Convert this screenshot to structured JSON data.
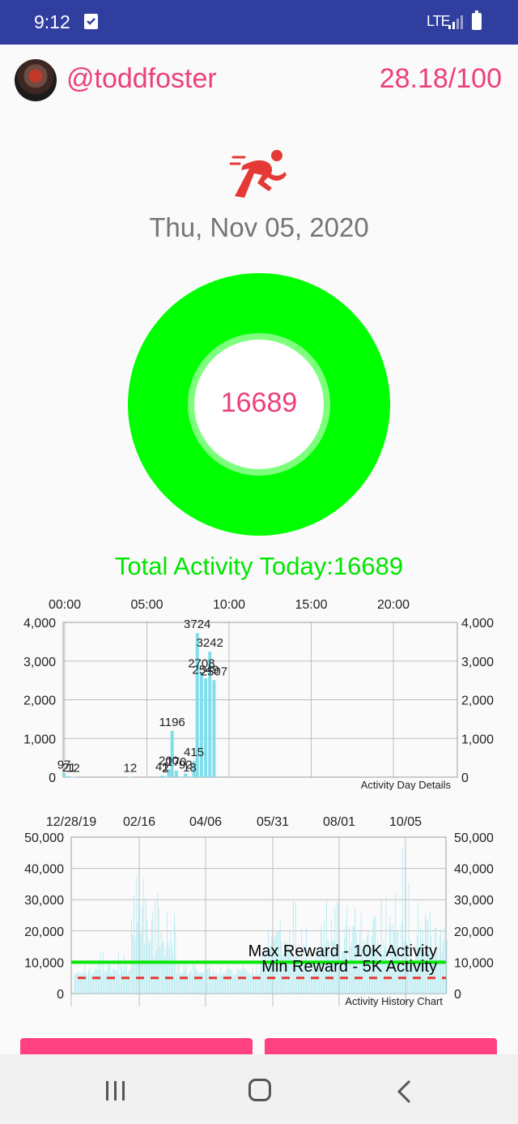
{
  "status_bar": {
    "time": "9:12",
    "network": "LTE",
    "icons": [
      "task-check-icon",
      "signal-icon",
      "battery-icon"
    ]
  },
  "header": {
    "username": "@toddfoster",
    "score": "28.18/100",
    "avatar": "user-avatar"
  },
  "activity_icon": "runner-icon",
  "date": "Thu, Nov 05, 2020",
  "ring": {
    "value": "16689",
    "color": "#00ff00"
  },
  "total_label": "Total Activity Today:16689",
  "chart_data": [
    {
      "type": "bar",
      "title": "Activity Day Details",
      "x_ticks": [
        "00:00",
        "05:00",
        "10:00",
        "15:00",
        "20:00"
      ],
      "x_range_hours": [
        0,
        24
      ],
      "y_ticks": [
        "0",
        "1,000",
        "2,000",
        "3,000",
        "4,000"
      ],
      "ylim": [
        0,
        4000
      ],
      "grid": true,
      "bar_color": "#80deea",
      "points": [
        {
          "hour": 0.05,
          "value": 97
        },
        {
          "hour": 0.35,
          "value": 21
        },
        {
          "hour": 0.6,
          "value": 12
        },
        {
          "hour": 4.0,
          "value": 12
        },
        {
          "hour": 5.9,
          "value": 41
        },
        {
          "hour": 6.1,
          "value": 2
        },
        {
          "hour": 6.3,
          "value": 200
        },
        {
          "hour": 6.5,
          "value": 1196
        },
        {
          "hour": 6.75,
          "value": 170
        },
        {
          "hour": 7.3,
          "value": 92
        },
        {
          "hour": 7.55,
          "value": 18
        },
        {
          "hour": 7.8,
          "value": 415
        },
        {
          "hour": 8.0,
          "value": 3724
        },
        {
          "hour": 8.25,
          "value": 2708
        },
        {
          "hour": 8.5,
          "value": 2549
        },
        {
          "hour": 8.75,
          "value": 3242
        },
        {
          "hour": 9.0,
          "value": 2507
        }
      ],
      "labels": [
        {
          "text": "97",
          "hour": 0.05,
          "value": 97
        },
        {
          "text": "21",
          "hour": 0.35,
          "value": 21
        },
        {
          "text": "12",
          "hour": 0.6,
          "value": 12
        },
        {
          "text": "12",
          "hour": 4.0,
          "value": 12
        },
        {
          "text": "41",
          "hour": 5.9,
          "value": 41
        },
        {
          "text": "2",
          "hour": 6.1,
          "value": 2
        },
        {
          "text": "200",
          "hour": 6.3,
          "value": 200
        },
        {
          "text": "1196",
          "hour": 6.5,
          "value": 1196
        },
        {
          "text": "170",
          "hour": 6.75,
          "value": 170
        },
        {
          "text": "92",
          "hour": 7.3,
          "value": 92
        },
        {
          "text": "18",
          "hour": 7.55,
          "value": 18
        },
        {
          "text": "415",
          "hour": 7.8,
          "value": 415
        },
        {
          "text": "3724",
          "hour": 8.0,
          "value": 3724
        },
        {
          "text": "2708",
          "hour": 8.25,
          "value": 2708
        },
        {
          "text": "2549",
          "hour": 8.5,
          "value": 2549
        },
        {
          "text": "3242",
          "hour": 8.75,
          "value": 3242
        },
        {
          "text": "2507",
          "hour": 9.0,
          "value": 2507
        }
      ]
    },
    {
      "type": "bar",
      "title": "Activity History Chart",
      "x_ticks": [
        "12/28/19",
        "02/16",
        "04/06",
        "05/31",
        "08/01",
        "10/05"
      ],
      "date_range": [
        "2019-12-28",
        "2020-11-05"
      ],
      "y_ticks": [
        "0",
        "10,000",
        "20,000",
        "30,000",
        "40,000",
        "50,000"
      ],
      "ylim": [
        0,
        50000
      ],
      "grid": true,
      "bar_color": "#b2ebf2",
      "daily_values": [
        0,
        6200,
        6100,
        6300,
        7000,
        6500,
        6800,
        6000,
        7200,
        6600,
        9000,
        6300,
        5900,
        7400,
        8300,
        5900,
        6900,
        6500,
        8000,
        7800,
        7600,
        10000,
        7700,
        12800,
        6400,
        13500,
        7700,
        6500,
        7500,
        8500,
        10500,
        9100,
        6400,
        7800,
        7500,
        8200,
        7200,
        7600,
        12900,
        6000,
        9200,
        8500,
        7300,
        12200,
        7900,
        8900,
        6400,
        7600,
        7700,
        23800,
        18900,
        31400,
        18000,
        37400,
        22800,
        29200,
        19200,
        18900,
        28000,
        36800,
        15900,
        30700,
        23400,
        18100,
        16200,
        16700,
        23700,
        26200,
        11300,
        30500,
        13800,
        32100,
        27300,
        15000,
        19700,
        16200,
        16900,
        11800,
        14900,
        25800,
        16500,
        14500,
        19600,
        15900,
        12600,
        25600,
        21500,
        6600,
        10000,
        9200,
        6000,
        6700,
        7000,
        9500,
        7600,
        9700,
        5700,
        6700,
        6300,
        7700,
        5700,
        9600,
        8800,
        8100,
        7600,
        6700,
        6600,
        6800,
        6700,
        7000,
        6500,
        7700,
        9600,
        7700,
        8200,
        9000,
        5600,
        6400,
        7800,
        5500,
        7000,
        5600,
        6700,
        5900,
        8300,
        5800,
        6800,
        5900,
        7000,
        7600,
        9100,
        8100,
        7800,
        7700,
        6500,
        5600,
        6600,
        6100,
        8200,
        7700,
        7600,
        7400,
        8000,
        9200,
        7300,
        8000,
        7200,
        6300,
        7100,
        6000,
        6600,
        8100,
        5700,
        6000,
        8900,
        6100,
        6000,
        7300,
        10400,
        13800,
        10800,
        14400,
        14100,
        5600,
        20700,
        9600,
        15600,
        18100,
        14500,
        17900,
        18600,
        20000,
        19700,
        19900,
        23300,
        16700,
        12300,
        12800,
        17100,
        15900,
        16400,
        14500,
        20500,
        12300,
        10800,
        29700,
        11300,
        29200,
        11800,
        12400,
        7900,
        10600,
        20700,
        9600,
        15900,
        10800,
        21200,
        6700,
        10200,
        12200,
        5800,
        11100,
        10400,
        11100,
        14100,
        10600,
        14000,
        10300,
        21600,
        19500,
        7500,
        23400,
        15100,
        29600,
        17400,
        16500,
        9300,
        23900,
        17100,
        16600,
        27900,
        13400,
        29100,
        28700,
        18600,
        6800,
        13700,
        13500,
        17800,
        21800,
        28100,
        10400,
        21600,
        14700,
        16600,
        21600,
        21600,
        27300,
        19500,
        12800,
        8700,
        19500,
        25800,
        14600,
        17100,
        10000,
        16700,
        18400,
        20400,
        11700,
        14600,
        18200,
        23400,
        24600,
        24500,
        13300,
        17400,
        9100,
        15500,
        29500,
        12600,
        17500,
        14800,
        31100,
        10900,
        10400,
        24200,
        21700,
        13300,
        22000,
        19900,
        32400,
        19400,
        19800,
        11400,
        10500,
        23000,
        46500,
        16700,
        23100,
        16300,
        11000,
        35200,
        8700,
        16700,
        10600,
        9900,
        7700,
        15300,
        18500,
        28800,
        13700,
        21100,
        16500,
        20000,
        13100,
        25200,
        23900,
        23300,
        13700,
        26300,
        18100,
        11700,
        11800,
        21000,
        21200,
        15700,
        10200,
        18400,
        20600,
        13400,
        16700,
        21200,
        20500,
        16900
      ],
      "reference_lines": [
        {
          "label": "Max Reward - 10K Activity",
          "value": 10000,
          "color": "#00e600",
          "style": "solid"
        },
        {
          "label": "Min Reward - 5K Activity",
          "value": 5000,
          "color": "#e53935",
          "style": "dashed"
        }
      ]
    }
  ],
  "buttons": [
    "",
    ""
  ],
  "nav": [
    "recent-apps",
    "home",
    "back"
  ]
}
